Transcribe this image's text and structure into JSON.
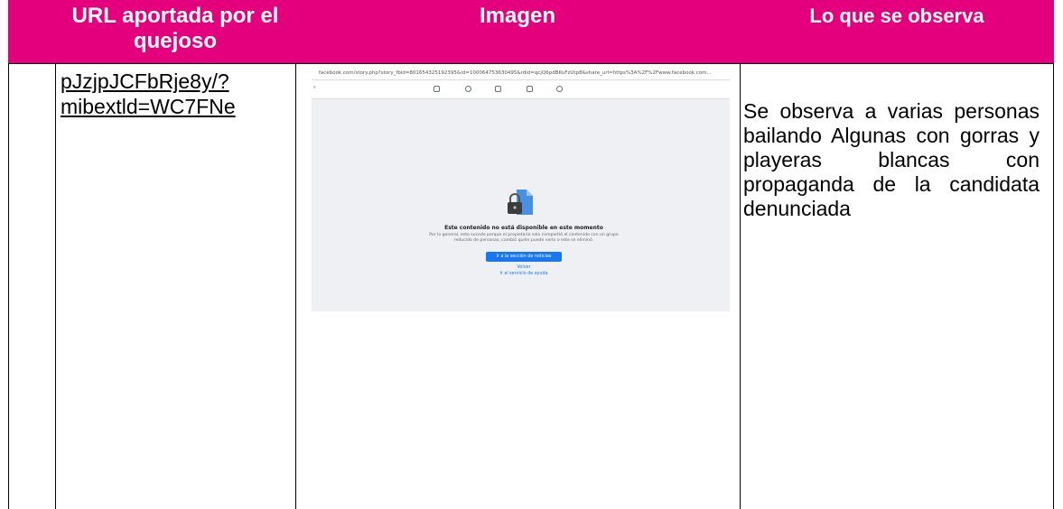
{
  "headers": {
    "url": "URL aportada por el quejoso",
    "image": "Imagen",
    "observed": "Lo que se observa"
  },
  "row": {
    "url_text": "pJzjpJCFbRje8y/?mibextld=WC7FNe",
    "observed_text": "Se observa a varias personas bailando Algunas con gorras y playeras blancas con propaganda de la candidata denunciada"
  },
  "screenshot": {
    "address": "facebook.com/story.php?story_fbid=801654325192395&id=100064753630495&rdid=qcjQ6pdBKuFzUtp8&share_url=https%3A%2F%2Fwww.facebook.com...",
    "search": "s",
    "title": "Este contenido no está disponible en este momento",
    "description": "Por lo general, esto sucede porque el propietario solo compartió el contenido con un grupo reducido de personas, cambió quién puede verlo o este se eliminó.",
    "button": "Ir a la sección de noticias",
    "back": "Volver",
    "help": "Ir al servicio de ayuda",
    "icons": [
      "home-icon",
      "friends-icon",
      "video-icon",
      "marketplace-icon",
      "groups-icon"
    ],
    "colors": {
      "accent": "#1877f2",
      "background": "#eef0f3"
    }
  },
  "colors": {
    "header": "#e4007c",
    "header_text": "#ffffff"
  }
}
